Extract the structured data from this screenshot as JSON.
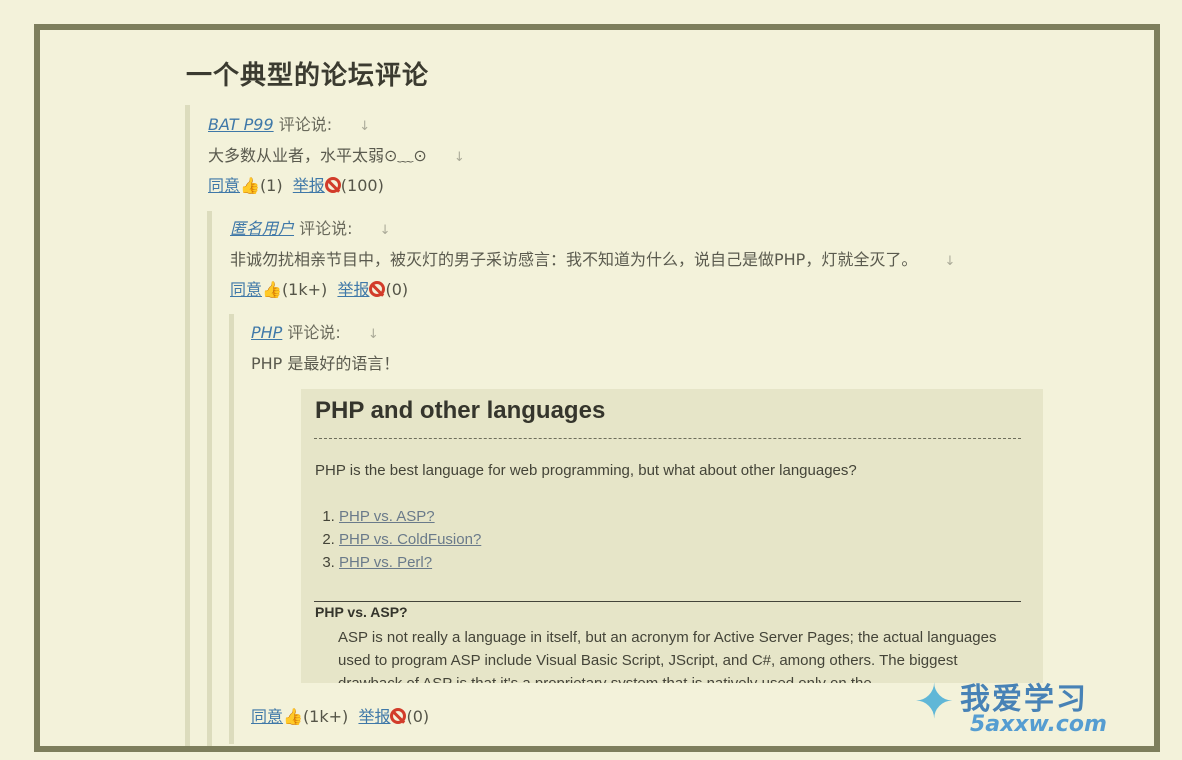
{
  "title": "一个典型的论坛评论",
  "comments": [
    {
      "author": "BAT P99",
      "said": "评论说:",
      "body": "大多数从业者，水平太弱⊙﹏⊙",
      "agree_label": "同意",
      "agree_count": "(1)",
      "report_label": "举报",
      "report_count": "(100)"
    },
    {
      "author": "匿名用户",
      "said": "评论说:",
      "body": "非诚勿扰相亲节目中，被灭灯的男子采访感言：我不知道为什么，说自己是做PHP，灯就全灭了。",
      "agree_label": "同意",
      "agree_count": "(1k+)",
      "report_label": "举报",
      "report_count": "(0)"
    },
    {
      "author": "PHP",
      "said": "评论说:",
      "body": "PHP 是最好的语言！",
      "agree_label": "同意",
      "agree_count": "(1k+)",
      "report_label": "举报",
      "report_count": "(0)"
    }
  ],
  "embed": {
    "heading": "PHP and other languages",
    "intro": "PHP is the best language for web programming, but what about other languages?",
    "links": [
      "PHP vs. ASP?",
      "PHP vs. ColdFusion?",
      "PHP vs. Perl?"
    ],
    "subheading": "PHP vs. ASP?",
    "paragraph": "ASP is not really a language in itself, but an acronym for Active Server Pages; the actual languages used to program ASP include Visual Basic Script, JScript, and C#, among others. The biggest drawback of ASP is that it's a proprietary system that is natively used only on the"
  },
  "icons": {
    "down_arrow": "↓",
    "thumb": "👍"
  },
  "watermark": {
    "cn": "我爱学习",
    "en": "5axxw.com"
  },
  "colors": {
    "background": "#f3f2da",
    "frame": "#7d7e5c",
    "link": "#3f78a8",
    "report": "#d23c2a"
  }
}
